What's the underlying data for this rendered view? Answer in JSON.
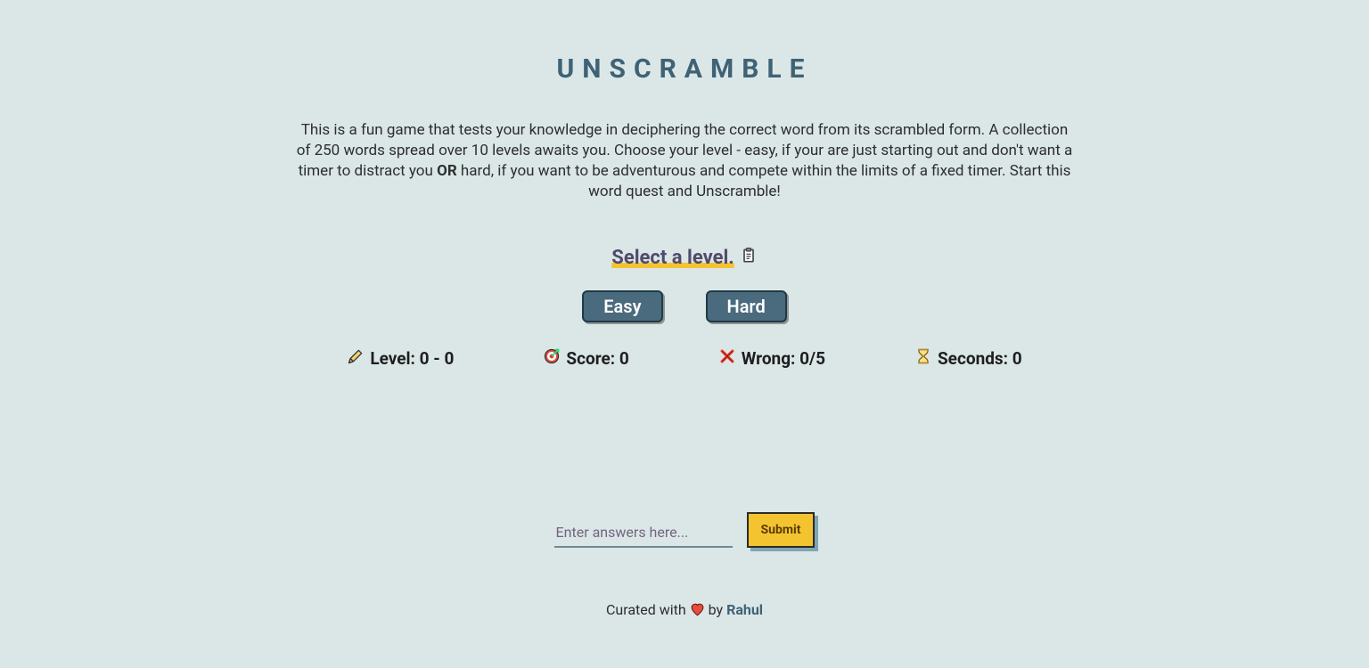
{
  "title": "UNSCRAMBLE",
  "intro_part1": "This is a fun game that tests your knowledge in deciphering the correct word from its scrambled form. A collection of 250 words spread over 10 levels awaits you. Choose your level - easy, if your are just starting out and don't want a timer to distract you ",
  "intro_bold": "OR",
  "intro_part2": " hard, if you want to be adventurous and compete within the limits of a fixed timer. Start this word quest and Unscramble!",
  "select_label": "Select a level.",
  "buttons": {
    "easy": "Easy",
    "hard": "Hard"
  },
  "stats": {
    "level_label": "Level: 0 - 0",
    "score_label": "Score: 0",
    "wrong_label": "Wrong: 0/5",
    "seconds_label": "Seconds: 0"
  },
  "answer_placeholder": "Enter answers here...",
  "submit_label": "Submit",
  "footer": {
    "prefix": "Curated with ",
    "by": " by ",
    "author": "Rahul"
  }
}
